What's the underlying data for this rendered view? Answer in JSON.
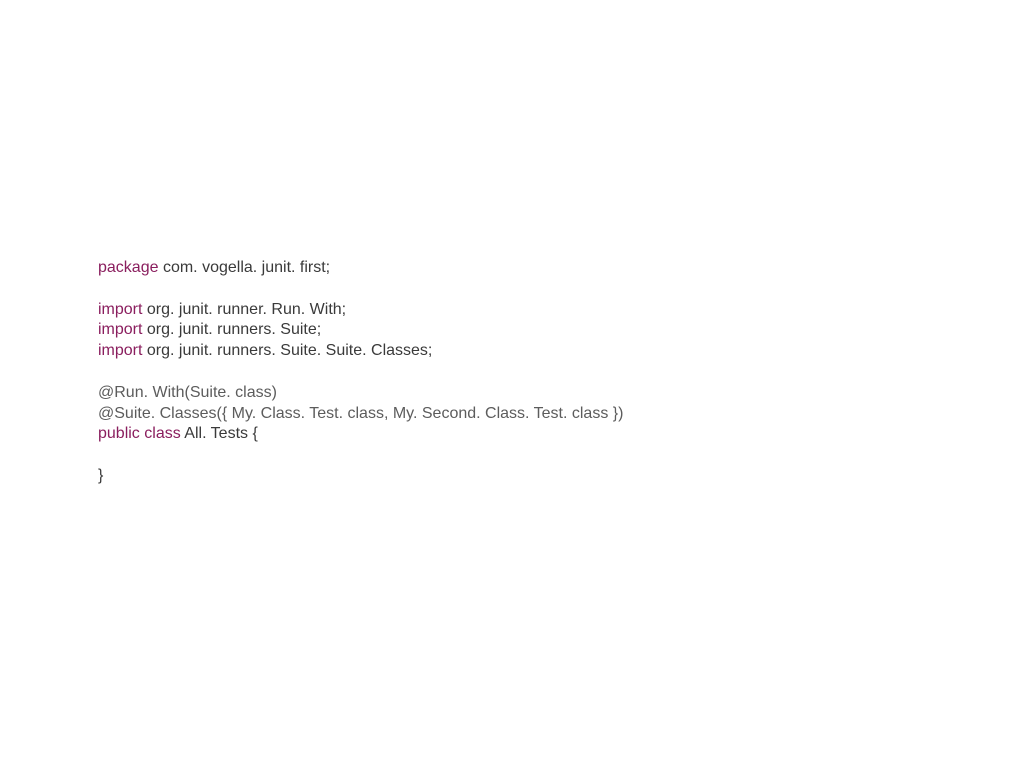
{
  "code": {
    "line1": {
      "kw": "package",
      "rest": " com. vogella. junit. first;"
    },
    "line2": {
      "kw": "import",
      "rest": " org. junit. runner. Run. With;"
    },
    "line3": {
      "kw": "import",
      "rest": " org. junit. runners. Suite;"
    },
    "line4": {
      "kw": "import",
      "rest": " org. junit. runners. Suite. Suite. Classes;"
    },
    "line5": "@Run. With(Suite. class)",
    "line6": "@Suite. Classes({ My. Class. Test. class, My. Second. Class. Test. class })",
    "line7": {
      "kw1": "public",
      "kw2": "class",
      "rest": " All. Tests {"
    },
    "line8": "}"
  }
}
